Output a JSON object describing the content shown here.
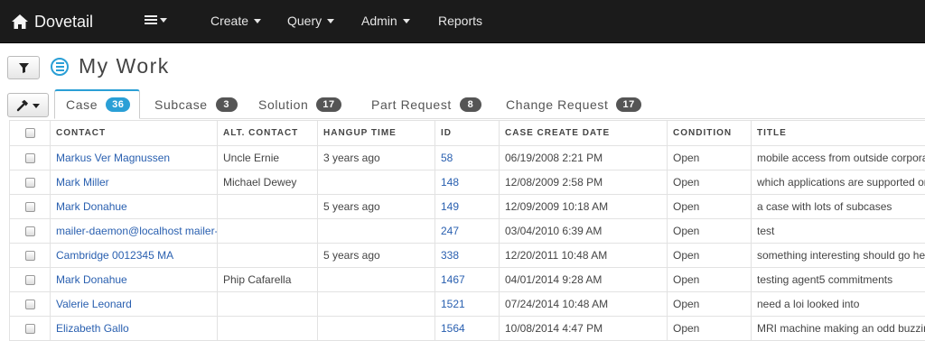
{
  "navbar": {
    "brand": "Dovetail",
    "items": [
      {
        "label": "Create",
        "dropdown": true
      },
      {
        "label": "Query",
        "dropdown": true
      },
      {
        "label": "Admin",
        "dropdown": true
      },
      {
        "label": "Reports",
        "dropdown": false
      }
    ]
  },
  "page": {
    "title": "My Work"
  },
  "tabs": [
    {
      "label": "Case",
      "count": "36",
      "active": true
    },
    {
      "label": "Subcase",
      "count": "3",
      "active": false
    },
    {
      "label": "Solution",
      "count": "17",
      "active": false
    },
    {
      "label": "Part Request",
      "count": "8",
      "active": false
    },
    {
      "label": "Change Request",
      "count": "17",
      "active": false
    }
  ],
  "table": {
    "columns": [
      "CONTACT",
      "ALT. CONTACT",
      "HANGUP TIME",
      "ID",
      "CASE CREATE DATE",
      "CONDITION",
      "TITLE"
    ],
    "rows": [
      [
        "Markus Ver Magnussen",
        "Uncle Ernie",
        "3 years ago",
        "58",
        "06/19/2008 2:21 PM",
        "Open",
        "mobile access from outside corporate"
      ],
      [
        "Mark Miller",
        "Michael Dewey",
        "",
        "148",
        "12/08/2009 2:58 PM",
        "Open",
        "which applications are supported on"
      ],
      [
        "Mark Donahue",
        "",
        "5 years ago",
        "149",
        "12/09/2009 10:18 AM",
        "Open",
        "a case with lots of subcases"
      ],
      [
        "mailer-daemon@localhost mailer-daemon",
        "",
        "",
        "247",
        "03/04/2010 6:39 AM",
        "Open",
        "test"
      ],
      [
        "Cambridge 0012345 MA",
        "",
        "5 years ago",
        "338",
        "12/20/2011 10:48 AM",
        "Open",
        "something interesting should go here"
      ],
      [
        "Mark Donahue",
        "Phip Cafarella",
        "",
        "1467",
        "04/01/2014 9:28 AM",
        "Open",
        "testing agent5 commitments"
      ],
      [
        "Valerie Leonard",
        "",
        "",
        "1521",
        "07/24/2014 10:48 AM",
        "Open",
        "need a loi looked into"
      ],
      [
        "Elizabeth Gallo",
        "",
        "",
        "1564",
        "10/08/2014 4:47 PM",
        "Open",
        "MRI machine making an odd buzzing"
      ]
    ]
  },
  "colors": {
    "navbar": "#1b1b1b",
    "accent": "#2a9fd6",
    "link": "#2a60b0",
    "badge": "#555555"
  },
  "icons": {
    "brand": "home-icon",
    "menu": "list-icon",
    "filter": "funnel-icon",
    "title": "list-circle-icon",
    "tool": "wrench-icon"
  }
}
